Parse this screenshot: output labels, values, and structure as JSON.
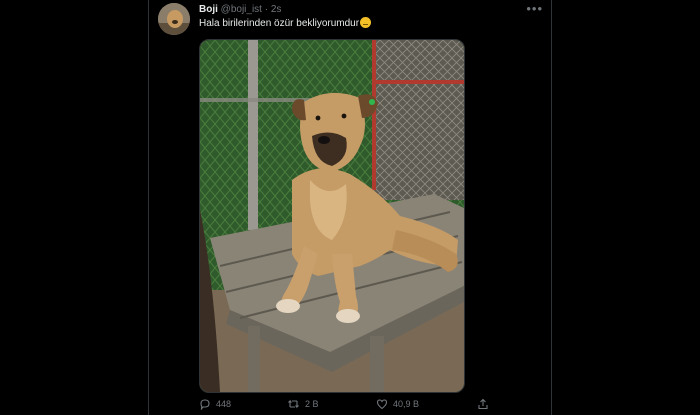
{
  "tweet": {
    "author_name": "Boji",
    "author_handle": "@boji_ist",
    "separator": "·",
    "timestamp": "2s",
    "text": "Hala birilerinden özür bekliyorumdur",
    "emoji": "thinking-face-emoji",
    "photo_alt": ""
  },
  "actions": {
    "replies": "448",
    "retweets": "2 B",
    "likes": "40,9 B"
  },
  "icons": {
    "more": "more-icon",
    "reply": "reply-icon",
    "retweet": "retweet-icon",
    "like": "heart-icon",
    "share": "share-icon"
  },
  "colors": {
    "background": "#000000",
    "text": "#e7e9ea",
    "muted": "#71767b",
    "border": "#2f3336"
  }
}
